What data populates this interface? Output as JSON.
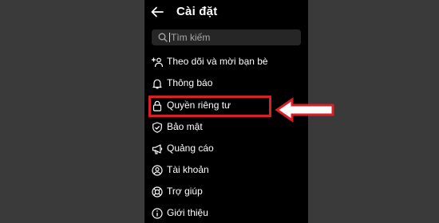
{
  "header": {
    "title": "Cài đặt",
    "back_icon": "arrow-left-icon"
  },
  "search": {
    "placeholder": "Tìm kiếm",
    "icon": "search-icon"
  },
  "menu": [
    {
      "label": "Theo dõi và mời bạn bè",
      "icon": "add-person-icon"
    },
    {
      "label": "Thông báo",
      "icon": "bell-icon"
    },
    {
      "label": "Quyền riêng tư",
      "icon": "lock-icon",
      "highlighted": true
    },
    {
      "label": "Bảo mật",
      "icon": "shield-check-icon"
    },
    {
      "label": "Quảng cáo",
      "icon": "megaphone-icon"
    },
    {
      "label": "Tài khoản",
      "icon": "account-circle-icon"
    },
    {
      "label": "Trợ giúp",
      "icon": "lifebuoy-icon"
    },
    {
      "label": "Giới thiệu",
      "icon": "info-icon"
    }
  ],
  "annotation": {
    "color": "#d8202a",
    "type": "arrow-pointing-left"
  },
  "colors": {
    "background": "#3a3a3a",
    "screen": "#000000",
    "text": "#ffffff",
    "search_bg": "#262626"
  }
}
